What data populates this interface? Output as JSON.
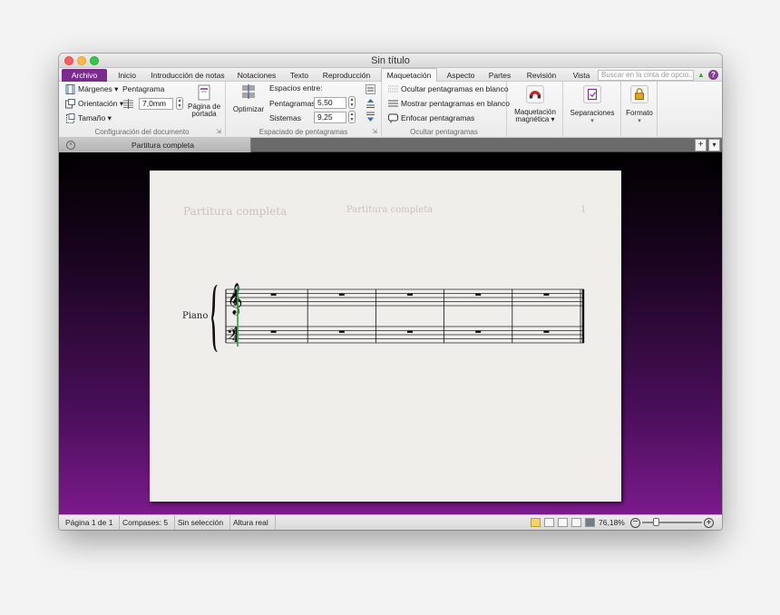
{
  "window": {
    "title": "Sin título"
  },
  "tabs": [
    "Archivo",
    "Inicio",
    "Introducción de notas",
    "Notaciones",
    "Texto",
    "Reproducción",
    "Maquetación",
    "Aspecto",
    "Partes",
    "Revisión",
    "Vista"
  ],
  "active_tab": "Maquetación",
  "search": {
    "placeholder": "Buscar en la cinta de opcio..."
  },
  "ribbon": {
    "doc_setup": {
      "margins": "Márgenes",
      "staff_label": "Pentagrama",
      "orientation": "Orientación",
      "staff_size": "7,0mm",
      "size": "Tamaño",
      "title_page_line1": "Página de",
      "title_page_line2": "portada",
      "label": "Configuración del documento"
    },
    "staff_spacing": {
      "optimize": "Optimizar",
      "spaces_between": "Espacios entre:",
      "staves_label": "Pentagramas",
      "staves_value": "5,50",
      "systems_label": "Sistemas",
      "systems_value": "9,25",
      "label": "Espaciado de pentagramas"
    },
    "hide_staves": {
      "hide_empty": "Ocultar pentagramas en blanco",
      "show_empty": "Mostrar pentagramas en blanco",
      "focus": "Enfocar pentagramas",
      "label": "Ocultar pentagramas"
    },
    "magnetic_line1": "Maquetación",
    "magnetic_line2": "magnética",
    "breaks": "Separaciones",
    "format": "Formato"
  },
  "document_tab": {
    "label": "Partitura completa"
  },
  "score": {
    "header_left": "Partitura completa",
    "header_center": "Partitura completa",
    "page_number": "1",
    "instrument": "Piano",
    "time_sig_top": "4",
    "time_sig_bottom": "4",
    "measures": 5
  },
  "status": {
    "page": "Página 1 de 1",
    "bars": "Compases: 5",
    "selection": "Sin selección",
    "height": "Altura real",
    "zoom": "76,18%",
    "zoom_fraction": 0.24
  },
  "colors": {
    "accent": "#7a2b8b",
    "workspace_bottom": "#7b1a8c",
    "selection": "#2e9e3e"
  }
}
